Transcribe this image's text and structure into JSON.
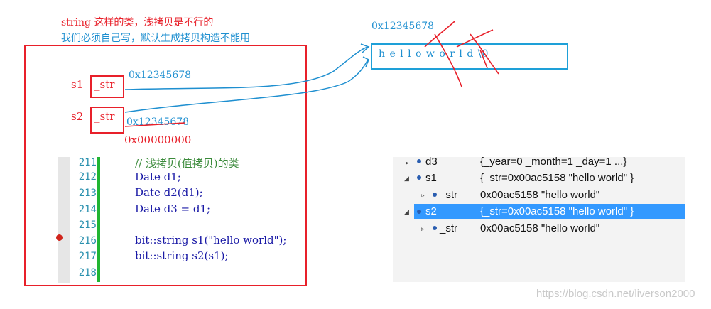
{
  "notes": {
    "line1": "string 这样的类，浅拷贝是不行的",
    "line2": "我们必须自己写，默认生成拷贝构造不能用"
  },
  "diagram": {
    "s1_label": "s1",
    "s2_label": "s2",
    "str_label": "_str",
    "addr1": "0x12345678",
    "addr2": "0x12345678",
    "addr_null": "0x00000000",
    "heap_addr": "0x12345678",
    "heap_chars": "h e l l o w o r l d \\0"
  },
  "editor": {
    "lines": [
      {
        "num": "211",
        "text": "// 浅拷贝(值拷贝)的类",
        "comment": true
      },
      {
        "num": "212",
        "text": "Date d1;"
      },
      {
        "num": "213",
        "text": "Date d2(d1);"
      },
      {
        "num": "214",
        "text": "Date d3 = d1;"
      },
      {
        "num": "215",
        "text": ""
      },
      {
        "num": "216",
        "text": "bit::string s1(\"hello world\");"
      },
      {
        "num": "217",
        "text": "bit::string s2(s1);"
      },
      {
        "num": "218",
        "text": ""
      }
    ]
  },
  "watch": {
    "rows": [
      {
        "name": "d3",
        "value": "{_year=0 _month=1 _day=1 ...}",
        "expander": "▸"
      },
      {
        "name": "s1",
        "value": "{_str=0x00ac5158 \"hello world\" }",
        "expander": "◢"
      },
      {
        "name": "_str",
        "value": "0x00ac5158 \"hello world\"",
        "expander": "▹"
      },
      {
        "name": "s2",
        "value": "{_str=0x00ac5158 \"hello world\" }",
        "expander": "◢"
      },
      {
        "name": "_str",
        "value": "0x00ac5158 \"hello world\"",
        "expander": "▹"
      }
    ]
  },
  "watermark": "https://blog.csdn.net/liverson2000",
  "colors": {
    "annotation_red": "#e8202a",
    "annotation_blue": "#1e8fd0",
    "selection": "#3399ff"
  }
}
